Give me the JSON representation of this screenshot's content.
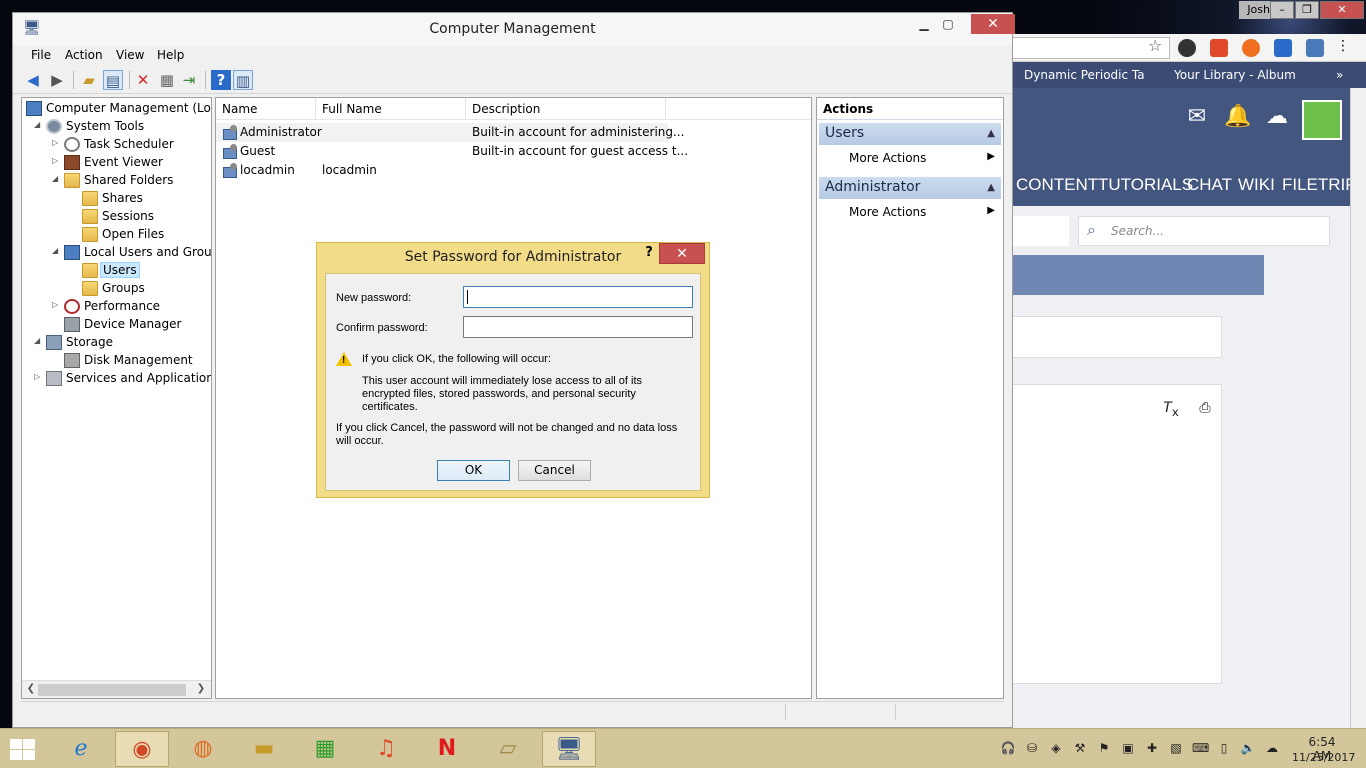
{
  "window": {
    "title": "Computer Management",
    "menus": [
      "File",
      "Action",
      "View",
      "Help"
    ]
  },
  "tree": {
    "items": [
      {
        "label": "Computer Management (Local",
        "icon": "computer-management-icon"
      },
      {
        "label": "System Tools",
        "icon": "system-tools-icon"
      },
      {
        "label": "Task Scheduler",
        "icon": "clock-icon"
      },
      {
        "label": "Event Viewer",
        "icon": "event-viewer-icon"
      },
      {
        "label": "Shared Folders",
        "icon": "shared-folder-icon"
      },
      {
        "label": "Shares",
        "icon": "shared-folder-icon"
      },
      {
        "label": "Sessions",
        "icon": "shared-folder-icon"
      },
      {
        "label": "Open Files",
        "icon": "shared-folder-icon"
      },
      {
        "label": "Local Users and Groups",
        "icon": "users-group-icon"
      },
      {
        "label": "Users",
        "icon": "folder-icon"
      },
      {
        "label": "Groups",
        "icon": "folder-icon"
      },
      {
        "label": "Performance",
        "icon": "performance-icon"
      },
      {
        "label": "Device Manager",
        "icon": "device-manager-icon"
      },
      {
        "label": "Storage",
        "icon": "storage-icon"
      },
      {
        "label": "Disk Management",
        "icon": "disk-icon"
      },
      {
        "label": "Services and Applications",
        "icon": "services-icon"
      }
    ]
  },
  "list": {
    "columns": [
      "Name",
      "Full Name",
      "Description"
    ],
    "rows": [
      {
        "name": "Administrator",
        "full_name": "",
        "description": "Built-in account for administering..."
      },
      {
        "name": "Guest",
        "full_name": "",
        "description": "Built-in account for guest access t..."
      },
      {
        "name": "locadmin",
        "full_name": "locadmin",
        "description": ""
      }
    ]
  },
  "actions": {
    "header": "Actions",
    "sections": [
      {
        "title": "Users",
        "item": "More Actions"
      },
      {
        "title": "Administrator",
        "item": "More Actions"
      }
    ]
  },
  "dialog": {
    "title": "Set Password for Administrator",
    "help": "?",
    "new_password_label": "New password:",
    "confirm_password_label": "Confirm password:",
    "new_password_value": "",
    "confirm_password_value": "",
    "warning_heading": "If you click OK, the following will occur:",
    "warning_body": "This user account will immediately lose access to all of its encrypted files, stored passwords, and personal security certificates.",
    "cancel_note": "If you click Cancel, the password will not be changed and no data loss will occur.",
    "ok": "OK",
    "cancel": "Cancel"
  },
  "browser": {
    "bookmarks": [
      "Dynamic Periodic Ta",
      "Your Library - Album"
    ],
    "nav": [
      "CONTENT",
      "TUTORIALS",
      "CHAT",
      "WIKI",
      "FILETRIP"
    ],
    "search_placeholder": "Search...",
    "more": "»"
  },
  "desktop": {
    "user": "Josh"
  },
  "taskbar": {
    "time": "6:54 AM",
    "date": "11/25/2017"
  },
  "colors": {
    "dialog_frame": "#f2dc88",
    "close_red": "#c75050",
    "action_header": "#cddcef",
    "site_blue": "#43567f",
    "taskbar": "#d4c69b"
  }
}
